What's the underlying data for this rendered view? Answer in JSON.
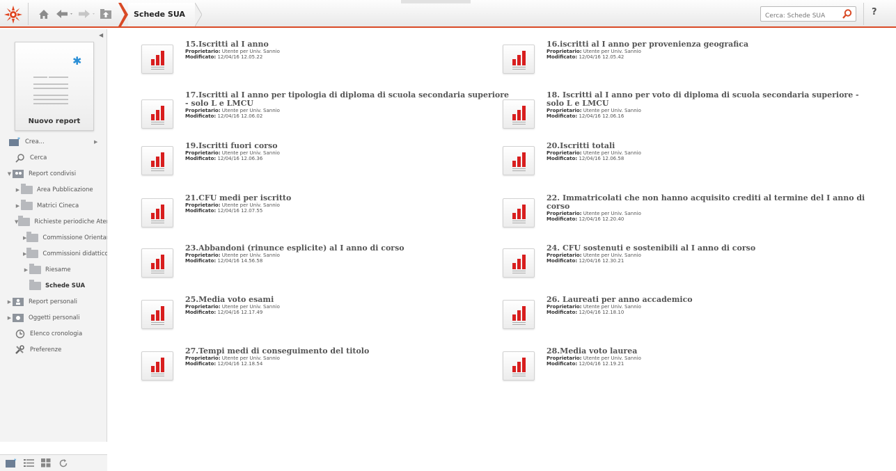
{
  "header": {
    "breadcrumb": "Schede SUA",
    "search_placeholder": "Cerca: Schede SUA",
    "help_label": "?",
    "accent_color": "#d94a26"
  },
  "sidebar": {
    "new_report_label": "Nuovo report",
    "items": [
      {
        "label": "Crea...",
        "icon": "create-icon"
      },
      {
        "label": "Cerca",
        "icon": "search-icon"
      },
      {
        "label": "Report condivisi",
        "icon": "shared-reports-icon"
      },
      {
        "label": "Area Pubblicazione",
        "icon": "folder-icon"
      },
      {
        "label": "Matrici Cineca",
        "icon": "folder-icon"
      },
      {
        "label": "Richieste periodiche Ateneo",
        "icon": "folder-icon"
      },
      {
        "label": "Commissione Orientamento",
        "icon": "folder-icon"
      },
      {
        "label": "Commissioni didattico paritetiche",
        "icon": "folder-icon"
      },
      {
        "label": "Riesame",
        "icon": "folder-icon"
      },
      {
        "label": "Schede SUA",
        "icon": "folder-icon"
      },
      {
        "label": "Report personali",
        "icon": "personal-reports-icon"
      },
      {
        "label": "Oggetti personali",
        "icon": "personal-objects-icon"
      },
      {
        "label": "Elenco cronologia",
        "icon": "history-icon"
      },
      {
        "label": "Preferenze",
        "icon": "preferences-icon"
      }
    ]
  },
  "labels": {
    "owner": "Proprietario:",
    "modified": "Modificato:"
  },
  "reports": [
    {
      "title": "15.Iscritti al I anno",
      "owner": "Utente per Univ. Sannio",
      "modified": "12/04/16 12.05.22"
    },
    {
      "title": "16.iscritti al I anno per provenienza geografica",
      "owner": "Utente per Univ. Sannio",
      "modified": "12/04/16 12.05.42"
    },
    {
      "title": "17.Iscritti al I anno per tipologia di diploma di scuola secondaria superiore - solo L e LMCU",
      "owner": "Utente per Univ. Sannio",
      "modified": "12/04/16 12.06.02"
    },
    {
      "title": "18. Iscritti al I anno per voto di diploma di scuola secondaria superiore - solo L e LMCU",
      "owner": "Utente per Univ. Sannio",
      "modified": "12/04/16 12.06.16"
    },
    {
      "title": "19.Iscritti fuori corso",
      "owner": "Utente per Univ. Sannio",
      "modified": "12/04/16 12.06.36"
    },
    {
      "title": "20.Iscritti totali",
      "owner": "Utente per Univ. Sannio",
      "modified": "12/04/16 12.06.58"
    },
    {
      "title": "21.CFU medi per iscritto",
      "owner": "Utente per Univ. Sannio",
      "modified": "12/04/16 12.07.55"
    },
    {
      "title": "22. Immatricolati che non hanno acquisito crediti al termine del I anno di corso",
      "owner": "Utente per Univ. Sannio",
      "modified": "12/04/16 12.20.40"
    },
    {
      "title": "23.Abbandoni (rinunce esplicite) al I anno di corso",
      "owner": "Utente per Univ. Sannio",
      "modified": "12/04/16 14.56.58"
    },
    {
      "title": "24. CFU sostenuti e sostenibili al I anno di corso",
      "owner": "Utente per Univ. Sannio",
      "modified": "12/04/16 12.30.21"
    },
    {
      "title": "25.Media voto esami",
      "owner": "Utente per Univ. Sannio",
      "modified": "12/04/16 12.17.49"
    },
    {
      "title": "26. Laureati per anno accademico",
      "owner": "Utente per Univ. Sannio",
      "modified": "12/04/16 12.18.10"
    },
    {
      "title": "27.Tempi medi di conseguimento del titolo",
      "owner": "Utente per Univ. Sannio",
      "modified": "12/04/16 12.18.54"
    },
    {
      "title": "28.Media voto laurea",
      "owner": "Utente per Univ. Sannio",
      "modified": "12/04/16 12.19.21"
    }
  ]
}
